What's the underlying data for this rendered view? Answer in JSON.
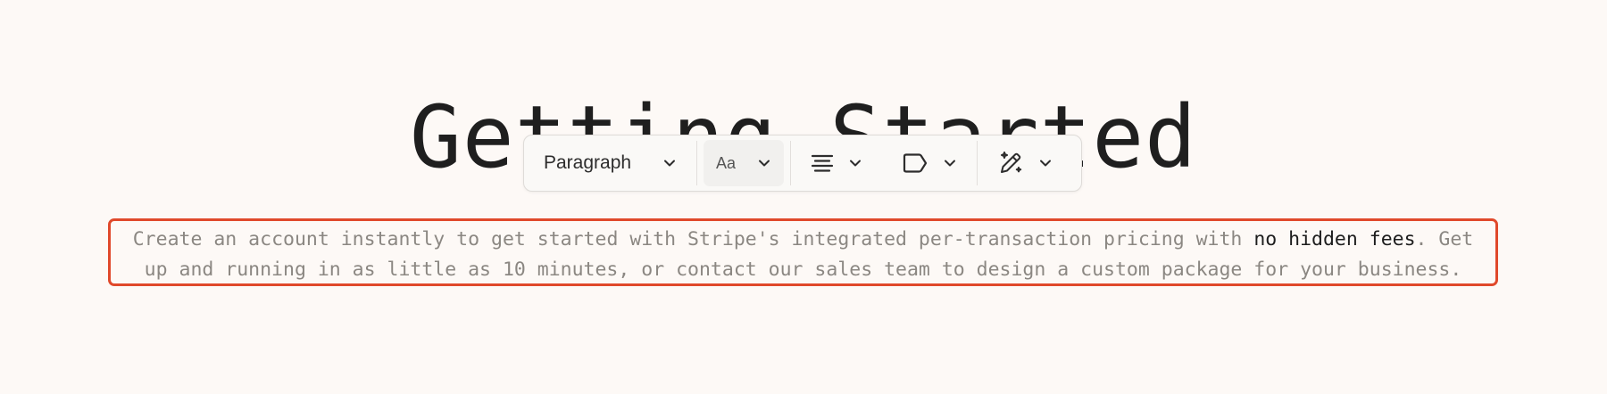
{
  "heading": "Getting Started",
  "toolbar": {
    "block_type_label": "Paragraph",
    "font_label": "Aa",
    "icons": [
      "chevron-down-icon",
      "align-center-icon",
      "tag-icon",
      "magic-pencil-icon"
    ]
  },
  "paragraph": {
    "before": "Create an account instantly to get started with Stripe's integrated per-transaction pricing with ",
    "highlight": "no hidden fees",
    "after": ". Get up and running in as little as 10 minutes, or contact our sales team to design a custom package for your business."
  },
  "colors": {
    "background": "#fdf9f6",
    "selection_border": "#e0492b",
    "muted_text": "#8b8782",
    "strong_text": "#1d1d1d"
  }
}
